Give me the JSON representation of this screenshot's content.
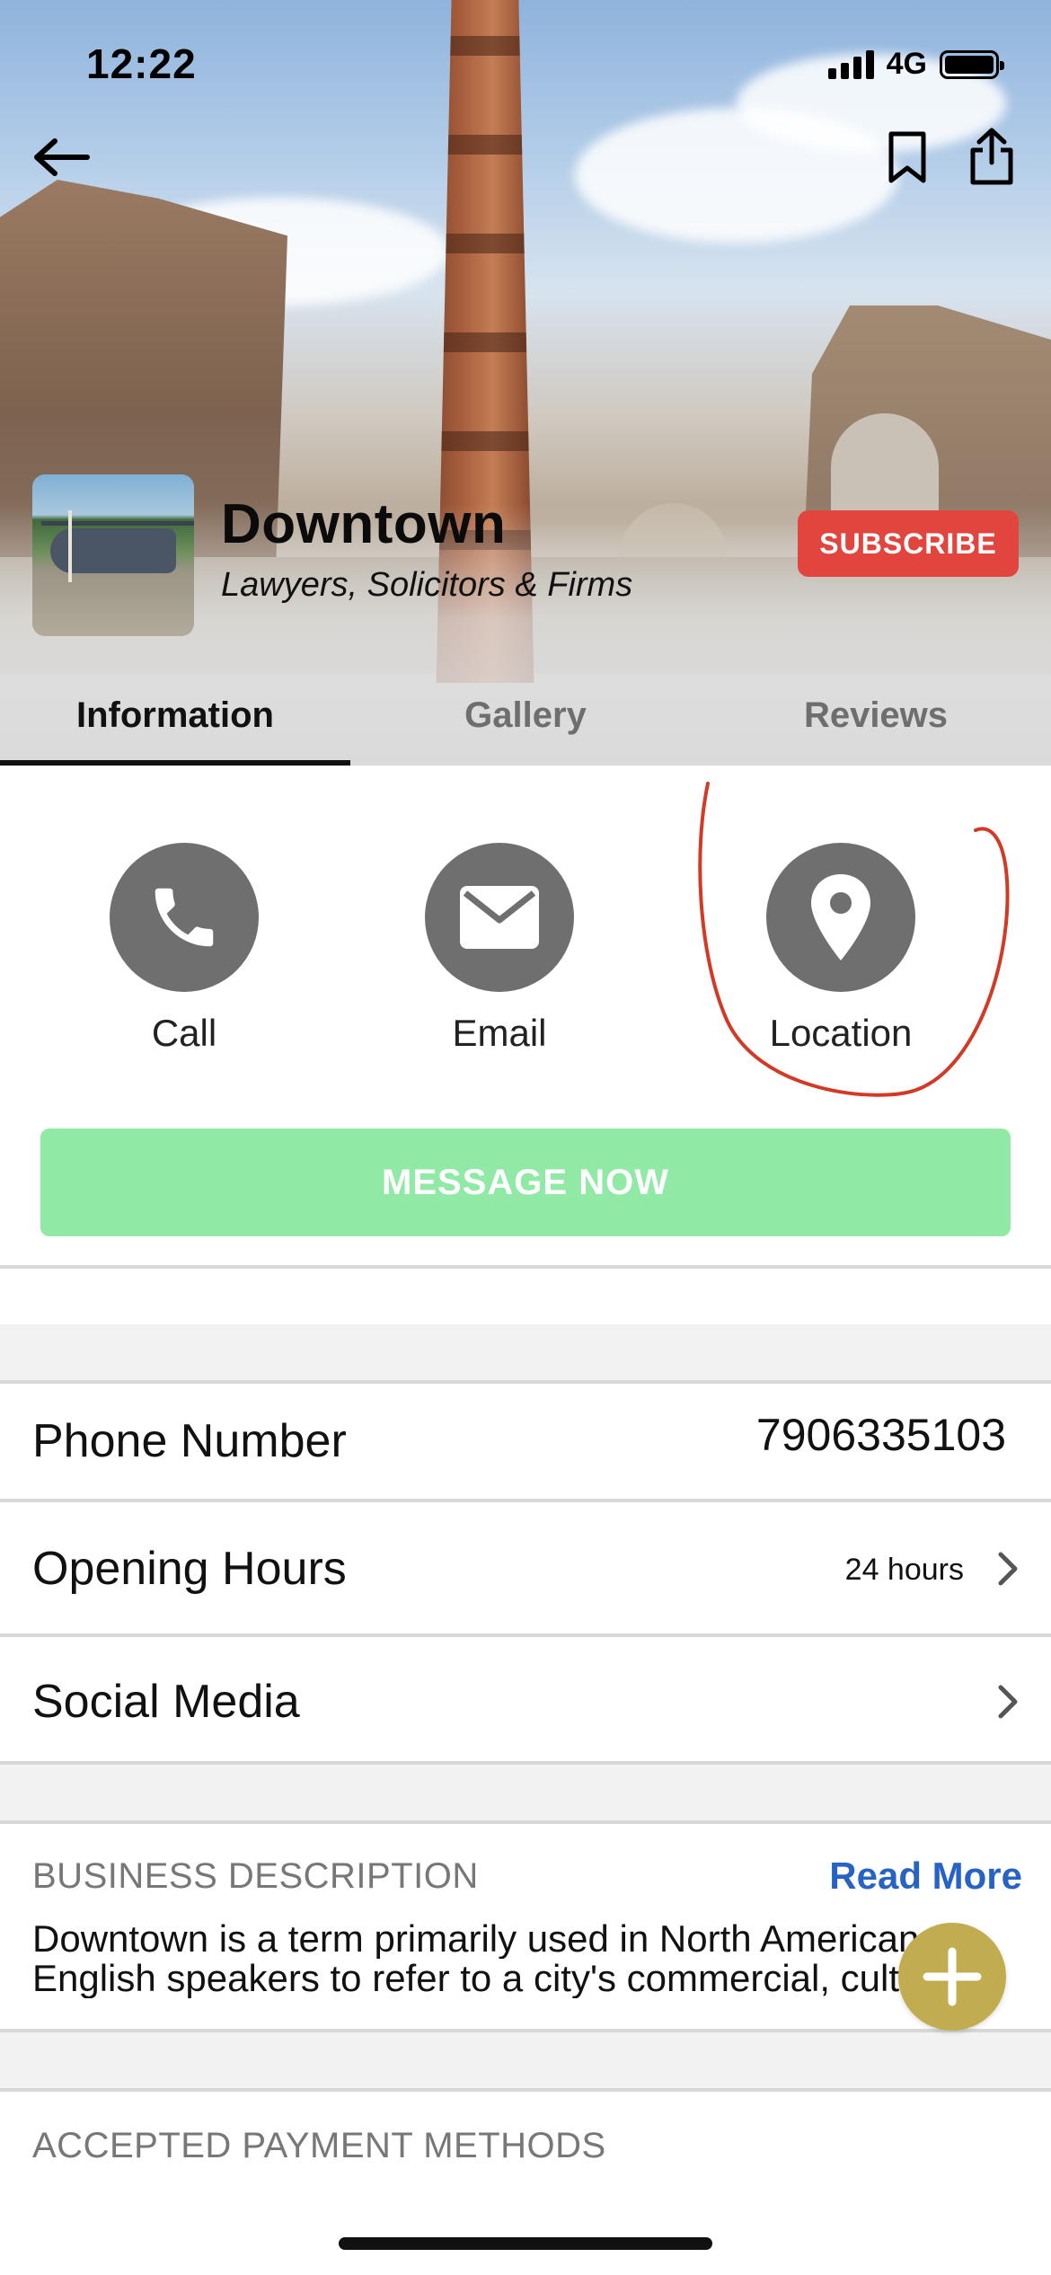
{
  "status_bar": {
    "time": "12:22",
    "network": "4G"
  },
  "header": {
    "back_icon": "arrow-left-icon",
    "bookmark_icon": "bookmark-icon",
    "share_icon": "share-icon"
  },
  "business": {
    "name": "Downtown",
    "category": "Lawyers, Solicitors & Firms",
    "subscribe_label": "SUBSCRIBE"
  },
  "tabs": [
    {
      "label": "Information",
      "active": true
    },
    {
      "label": "Gallery",
      "active": false
    },
    {
      "label": "Reviews",
      "active": false
    }
  ],
  "actions": [
    {
      "label": "Call",
      "icon": "phone-icon"
    },
    {
      "label": "Email",
      "icon": "envelope-icon"
    },
    {
      "label": "Location",
      "icon": "map-pin-icon"
    }
  ],
  "message_button": "MESSAGE NOW",
  "details": {
    "phone": {
      "label": "Phone Number",
      "value": "7906335103"
    },
    "hours": {
      "label": "Opening Hours",
      "value": "24 hours"
    },
    "social": {
      "label": "Social Media"
    }
  },
  "description": {
    "heading": "BUSINESS DESCRIPTION",
    "read_more": "Read More",
    "line1": "Downtown is a term primarily used in North American",
    "line2": "English speakers to refer to a city's commercial, cultural"
  },
  "payment": {
    "heading": "ACCEPTED PAYMENT METHODS"
  },
  "colors": {
    "subscribe": "#e2443e",
    "message": "#90e9a4",
    "action_circle": "#6f6f6f",
    "read_more": "#2663c4",
    "fab": "#c1ad4f",
    "annotation": "#d23a26"
  }
}
